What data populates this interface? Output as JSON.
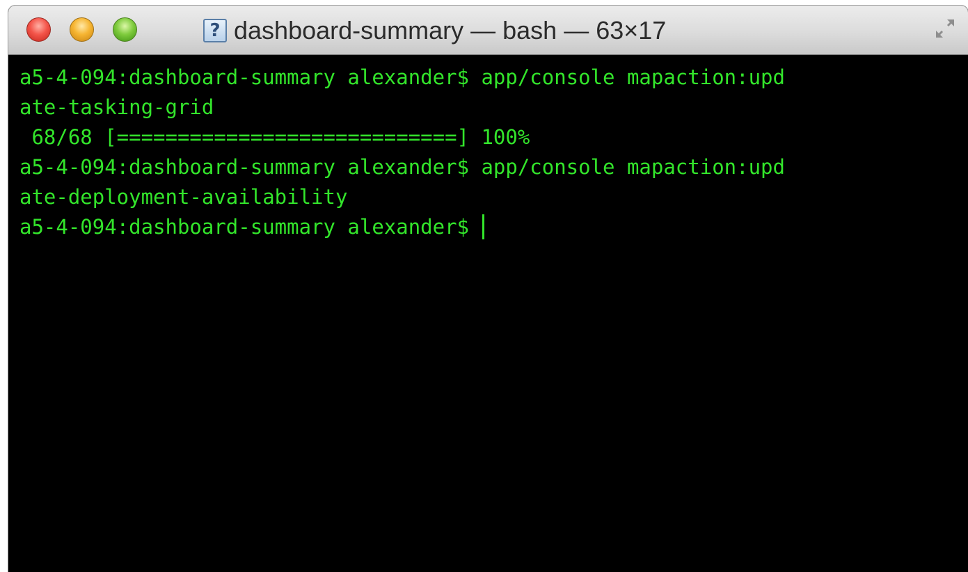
{
  "window": {
    "title": "dashboard-summary — bash — 63×17",
    "title_icon_glyph": "?",
    "icons": {
      "close": "close-button",
      "minimize": "minimize-button",
      "zoom": "zoom-button",
      "fullscreen": "fullscreen-icon",
      "title": "document-icon"
    },
    "colors": {
      "terminal_background": "#000000",
      "terminal_text": "#33e52b"
    }
  },
  "terminal": {
    "lines": [
      "a5-4-094:dashboard-summary alexander$ app/console mapaction:upd",
      "ate-tasking-grid",
      " 68/68 [============================] 100%",
      "a5-4-094:dashboard-summary alexander$ app/console mapaction:upd",
      "ate-deployment-availability",
      "a5-4-094:dashboard-summary alexander$ "
    ],
    "progress": {
      "current": 68,
      "total": 68,
      "percent": 100
    }
  }
}
